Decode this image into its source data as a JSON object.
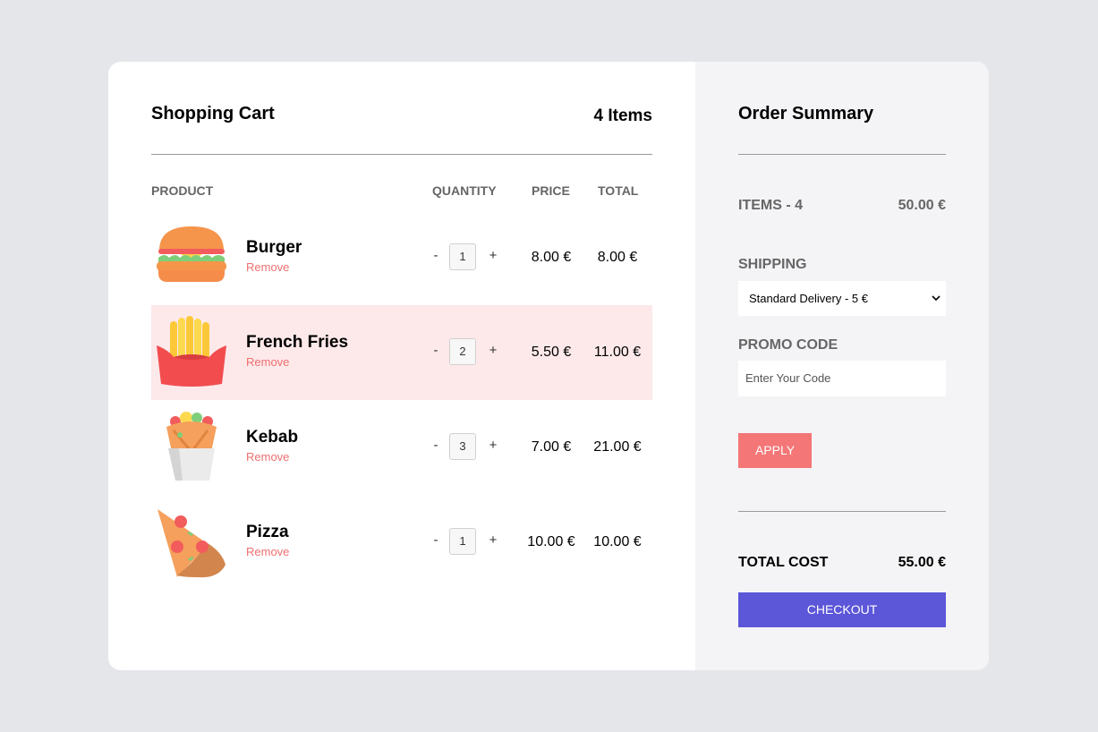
{
  "cart": {
    "title": "Shopping Cart",
    "count": "4 Items",
    "headers": {
      "product": "PRODUCT",
      "quantity": "QUANTITY",
      "price": "PRICE",
      "total": "TOTAL"
    },
    "minus_label": "-",
    "plus_label": "+",
    "items": [
      {
        "name": "Burger",
        "remove": "Remove",
        "quantity": "1",
        "price": "8.00 €",
        "total": "8.00 €",
        "icon": "burger-icon"
      },
      {
        "name": "French Fries",
        "remove": "Remove",
        "quantity": "2",
        "price": "5.50 €",
        "total": "11.00 €",
        "icon": "french-fries-icon",
        "highlighted": true
      },
      {
        "name": "Kebab",
        "remove": "Remove",
        "quantity": "3",
        "price": "7.00 €",
        "total": "21.00 €",
        "icon": "kebab-icon"
      },
      {
        "name": "Pizza",
        "remove": "Remove",
        "quantity": "1",
        "price": "10.00 €",
        "total": "10.00 €",
        "icon": "pizza-icon"
      }
    ]
  },
  "summary": {
    "title": "Order Summary",
    "items_label": "ITEMS - 4",
    "items_value": "50.00 €",
    "shipping_label": "SHIPPING",
    "shipping_selected": "Standard Delivery - 5 €",
    "promo_label": "PROMO CODE",
    "promo_placeholder": "Enter Your Code",
    "apply_label": "APPLY",
    "total_label": "TOTAL COST",
    "total_value": "55.00 €",
    "checkout_label": "CHECKOUT"
  },
  "colors": {
    "page_background": "#e5e6ea",
    "summary_background": "#f4f4f6",
    "highlight_row": "#fde9ea",
    "remove_link": "#ef6f6f",
    "apply_button": "#f47676",
    "checkout_button": "#5c56d8"
  }
}
